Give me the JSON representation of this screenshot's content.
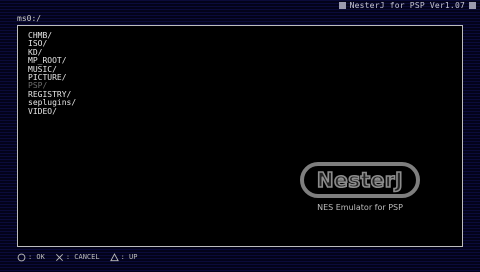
{
  "window": {
    "title": "NesterJ for PSP Ver1.07"
  },
  "browser": {
    "path": "ms0:/",
    "items": [
      {
        "label": "CHMB/",
        "dim": false
      },
      {
        "label": "ISO/",
        "dim": false
      },
      {
        "label": "KD/",
        "dim": false
      },
      {
        "label": "MP_ROOT/",
        "dim": false
      },
      {
        "label": "MUSIC/",
        "dim": false
      },
      {
        "label": "PICTURE/",
        "dim": false
      },
      {
        "label": "PSP/",
        "dim": true
      },
      {
        "label": "REGISTRY/",
        "dim": false
      },
      {
        "label": "seplugins/",
        "dim": false
      },
      {
        "label": "VIDEO/",
        "dim": false
      }
    ]
  },
  "logo": {
    "text": "NesterJ",
    "subtitle": "NES Emulator for PSP"
  },
  "footer": {
    "hints": [
      {
        "icon": "circle-icon",
        "label": ": OK"
      },
      {
        "icon": "cross-icon",
        "label": ": CANCEL"
      },
      {
        "icon": "triangle-icon",
        "label": ": UP"
      }
    ]
  }
}
